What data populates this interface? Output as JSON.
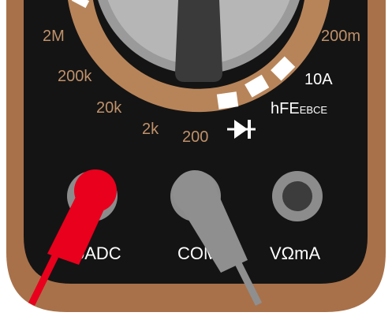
{
  "dial": {
    "ranges": {
      "r2M": "2M",
      "r200k": "200k",
      "r20k": "20k",
      "r2k": "2k",
      "r200": "200",
      "r200m": "200m",
      "r10A": "10A",
      "hfe_main": "hFE",
      "hfe_sub": "EBCE"
    }
  },
  "jacks": {
    "left_label": "0ADC",
    "com_label": "COM",
    "right_label": "VΩmA"
  },
  "colors": {
    "body": "#a8714a",
    "face": "#141414",
    "dial_track": "#b78459",
    "marker": "#ffffff",
    "knob_ring": "#9a9a9a",
    "knob": "#b6b6b6",
    "pointer": "#3a3a3a",
    "red_probe": "#e8001c",
    "black_probe": "#8f8f8f",
    "label": "#c0916a"
  }
}
